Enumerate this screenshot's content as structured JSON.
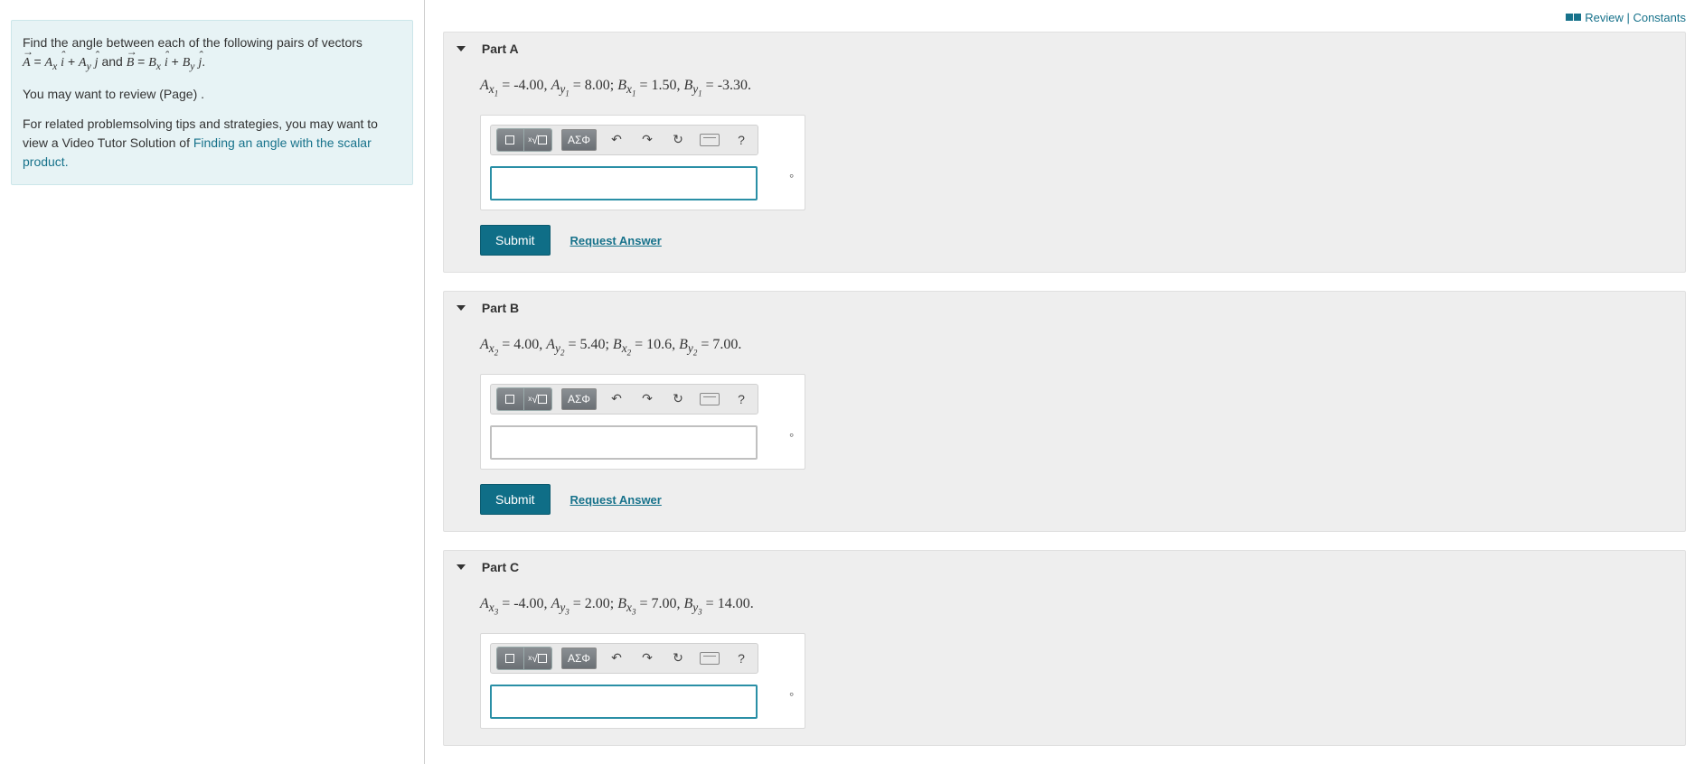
{
  "sidebar": {
    "intro_line": "Find the angle between each of the following pairs of vectors",
    "review_line": "You may want to review (Page) .",
    "related_pre": "For related problemsolving tips and strategies, you may want to view a Video Tutor Solution of ",
    "related_link": "Finding an angle with the scalar product."
  },
  "top": {
    "review": "Review",
    "constants": "Constants"
  },
  "toolbar": {
    "symbols_label": "ΑΣΦ",
    "help": "?"
  },
  "actions": {
    "submit": "Submit",
    "request": "Request Answer"
  },
  "parts": [
    {
      "title": "Part A",
      "vals": {
        "Ax": "-4.00",
        "Ay": "8.00",
        "Bx": "1.50",
        "By": "-3.30",
        "idx": "1"
      },
      "unit": "°",
      "show_actions": true
    },
    {
      "title": "Part B",
      "vals": {
        "Ax": "4.00",
        "Ay": "5.40",
        "Bx": "10.6",
        "By": "7.00",
        "idx": "2"
      },
      "unit": "°",
      "show_actions": true
    },
    {
      "title": "Part C",
      "vals": {
        "Ax": "-4.00",
        "Ay": "2.00",
        "Bx": "7.00",
        "By": "14.00",
        "idx": "3"
      },
      "unit": "°",
      "show_actions": false
    }
  ]
}
